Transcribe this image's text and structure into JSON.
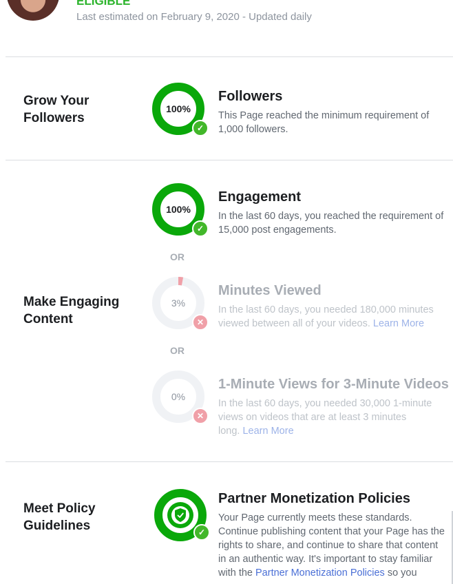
{
  "header": {
    "status": "ELIGIBLE",
    "estimate": "Last estimated on February 9, 2020 - Updated daily"
  },
  "sections": {
    "grow": {
      "title_l1": "Grow Your",
      "title_l2": "Followers",
      "followers": {
        "title": "Followers",
        "percent_label": "100%",
        "percent": 100,
        "status": "met",
        "text_l1": "This Page reached the minimum requirement of",
        "text_l2": "1,000 followers."
      }
    },
    "engage": {
      "title_l1": "Make Engaging",
      "title_l2": "Content",
      "or_label": "OR",
      "engagement": {
        "title": "Engagement",
        "percent_label": "100%",
        "percent": 100,
        "status": "met",
        "text_l1": "In the last 60 days, you reached the requirement of",
        "text_l2": "15,000 post engagements."
      },
      "minutes": {
        "title": "Minutes Viewed",
        "percent_label": "3%",
        "percent": 3,
        "status": "not-met",
        "text_l1": "In the last 60 days, you needed 180,000 minutes",
        "text_l2": "viewed between all of your videos.",
        "link": "Learn More"
      },
      "oneminute": {
        "title": "1-Minute Views for 3-Minute Videos",
        "percent_label": "0%",
        "percent": 0,
        "status": "not-met",
        "text_l1": "In the last 60 days, you needed 30,000 1-minute",
        "text_l2": "views on videos that are at least 3 minutes",
        "text_l3": "long.",
        "link": "Learn More"
      }
    },
    "policy": {
      "title_l1": "Meet Policy",
      "title_l2": "Guidelines",
      "title": "Partner Monetization Policies",
      "icon": "shield-icon",
      "status": "met",
      "text_l1": "Your Page currently meets these standards.",
      "text_l2": "Continue publishing content that your Page has the",
      "text_l3": "rights to share, and continue to share that content",
      "text_l4": "in an authentic way. It's important to stay familiar",
      "text_l5_pre": "with the",
      "text_l5_link": "Partner Monetization Policies",
      "text_l5_post": "so you"
    }
  },
  "colors": {
    "success": "#0aa80a",
    "fail": "#f0a0a8",
    "track": "#f0f2f5",
    "link": "#4a6fd6"
  }
}
